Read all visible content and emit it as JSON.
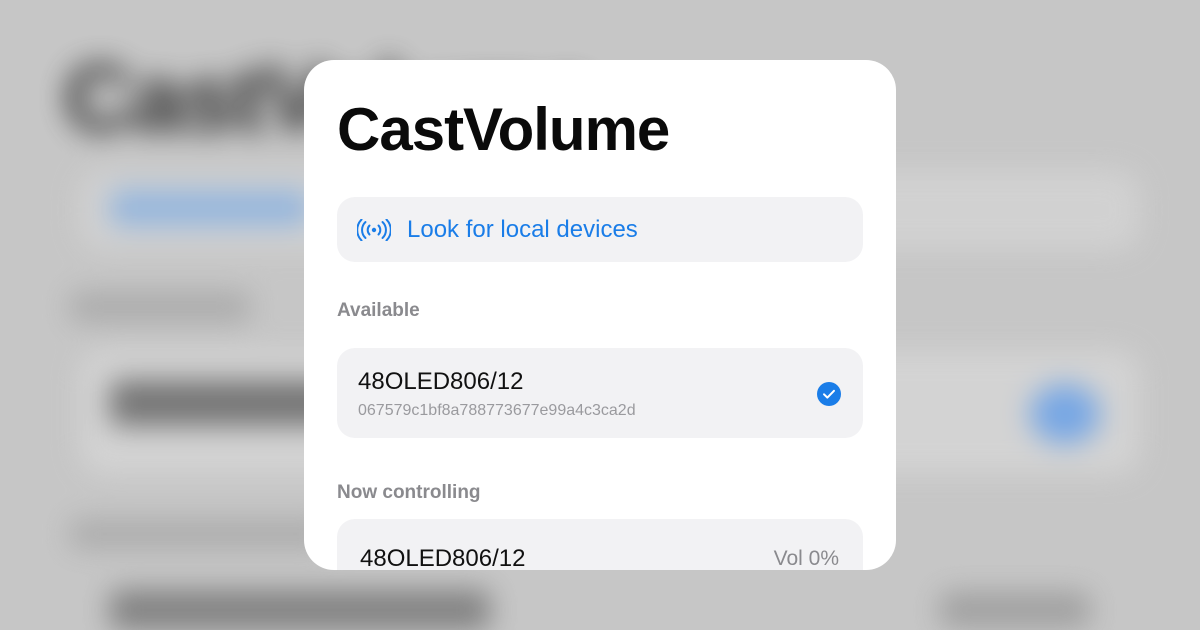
{
  "app": {
    "title": "CastVolume"
  },
  "discovery": {
    "button_label": "Look for local devices",
    "icon": "broadcast-icon"
  },
  "available": {
    "section_label": "Available",
    "devices": [
      {
        "name": "48OLED806/12",
        "id": "067579c1bf8a788773677e99a4c3ca2d",
        "selected": true,
        "icon": "checkmark-circle-icon"
      }
    ]
  },
  "controlling": {
    "section_label": "Now controlling",
    "device_name": "48OLED806/12",
    "volume_label": "Vol 0%"
  },
  "colors": {
    "accent": "#1a7de8",
    "card_background": "#ffffff",
    "row_background": "#f2f2f4",
    "secondary_text": "#8a8a8e"
  }
}
